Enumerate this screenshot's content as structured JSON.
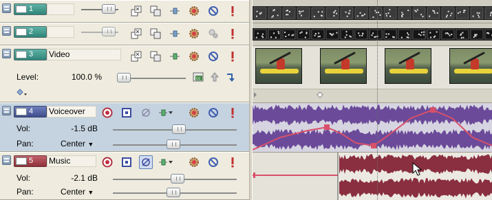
{
  "tracks": [
    {
      "number": "1",
      "name": "",
      "type": "video"
    },
    {
      "number": "2",
      "name": "",
      "type": "video"
    },
    {
      "number": "3",
      "name": "Video",
      "type": "video",
      "level_label": "Level:",
      "level_value": "100.0 %",
      "level_fraction": 1.0
    },
    {
      "number": "4",
      "name": "Voiceover",
      "type": "audio",
      "selected": true,
      "vol_label": "Vol:",
      "vol_value": "-1.5 dB",
      "pan_label": "Pan:",
      "pan_value": "Center"
    },
    {
      "number": "5",
      "name": "Music",
      "type": "audio",
      "vol_label": "Vol:",
      "vol_value": "-2.1 dB",
      "pan_label": "Pan:",
      "pan_value": "Center"
    }
  ],
  "colors": {
    "video_track": "#3f9b8e",
    "voiceover_track": "#4c5aa0",
    "music_track": "#a0424c",
    "voiceover_wave": "#6b4a9a",
    "music_wave": "#8a2f3f",
    "envelope": "#d8506a"
  },
  "icons": {
    "track_header": [
      "grip-icon",
      "track-badge-icon"
    ],
    "video_controls": [
      "fx-icon",
      "compositing-icon",
      "motion-icon",
      "gear-icon",
      "mute-icon",
      "solo-icon"
    ],
    "audio_controls": [
      "record-arm-icon",
      "input-monitor-icon",
      "invert-phase-icon",
      "fx-chain-icon",
      "gear-icon",
      "mute-icon",
      "solo-icon"
    ]
  }
}
